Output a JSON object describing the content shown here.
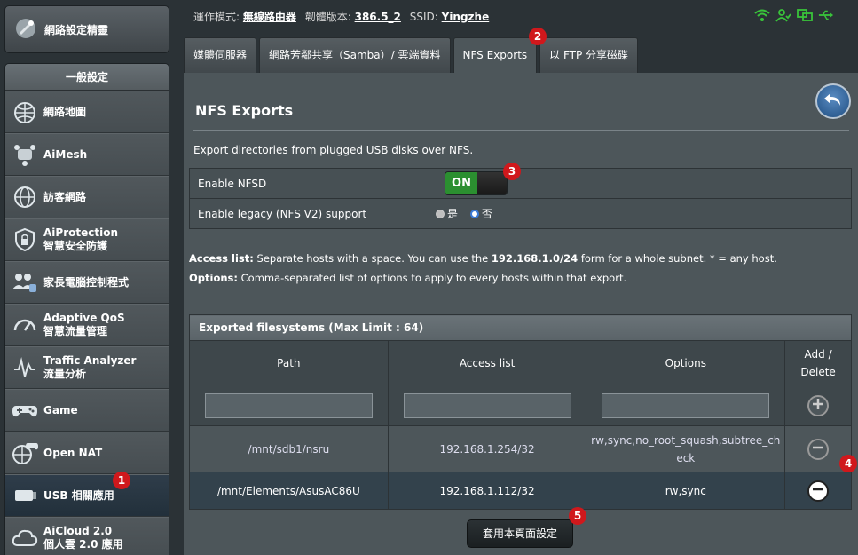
{
  "sidebar": {
    "wizard_label": "網路設定精靈",
    "section_title": "一般設定",
    "items": [
      {
        "label": "網路地圖",
        "sub": ""
      },
      {
        "label": "AiMesh",
        "sub": ""
      },
      {
        "label": "訪客網路",
        "sub": ""
      },
      {
        "label": "AiProtection",
        "sub": "智慧安全防護"
      },
      {
        "label": "家長電腦控制程式",
        "sub": ""
      },
      {
        "label": "Adaptive QoS",
        "sub": "智慧流量管理"
      },
      {
        "label": "Traffic Analyzer",
        "sub": "流量分析"
      },
      {
        "label": "Game",
        "sub": ""
      },
      {
        "label": "Open NAT",
        "sub": ""
      },
      {
        "label": "USB 相關應用",
        "sub": ""
      },
      {
        "label": "AiCloud 2.0",
        "sub": "個人雲 2.0 應用"
      }
    ]
  },
  "topbar": {
    "mode_label": "運作模式:",
    "mode_value": "無線路由器",
    "fw_label": "韌體版本:",
    "fw_value": "386.5_2",
    "ssid_label": "SSID:",
    "ssid_value": "Yingzhe"
  },
  "tabs": [
    "媒體伺服器",
    "網路芳鄰共享（Samba）/ 雲端資料",
    "NFS Exports",
    "以 FTP 分享磁碟"
  ],
  "page": {
    "title": "NFS Exports",
    "description": "Export directories from plugged USB disks over NFS.",
    "enable_nfsd_label": "Enable NFSD",
    "toggle_on": "ON",
    "legacy_label": "Enable legacy (NFS V2) support",
    "radio_yes": "是",
    "radio_no": "否",
    "note1_bold": "Access list:",
    "note1_a": " Separate hosts with a space. You can use the ",
    "note1_bold2": "192.168.1.0/24",
    "note1_b": " form for a whole subnet. * = any host.",
    "note2_bold": "Options:",
    "note2_text": " Comma-separated list of options to apply to every hosts within that export."
  },
  "exports": {
    "caption": "Exported filesystems (Max Limit : 64)",
    "headers": {
      "path": "Path",
      "access": "Access list",
      "options": "Options",
      "add_delete": "Add / Delete"
    },
    "rows": [
      {
        "path": "/mnt/sdb1/nsru",
        "access": "192.168.1.254/32",
        "options": "rw,sync,no_root_squash,subtree_check"
      },
      {
        "path": "/mnt/Elements/AsusAC86U",
        "access": "192.168.1.112/32",
        "options": "rw,sync"
      }
    ]
  },
  "apply_label": "套用本頁面設定",
  "badges": [
    "1",
    "2",
    "3",
    "4",
    "5"
  ],
  "colors": {
    "accent_green": "#2b8f30",
    "badge_red": "#d0181c",
    "icon_green": "#39c33a"
  }
}
